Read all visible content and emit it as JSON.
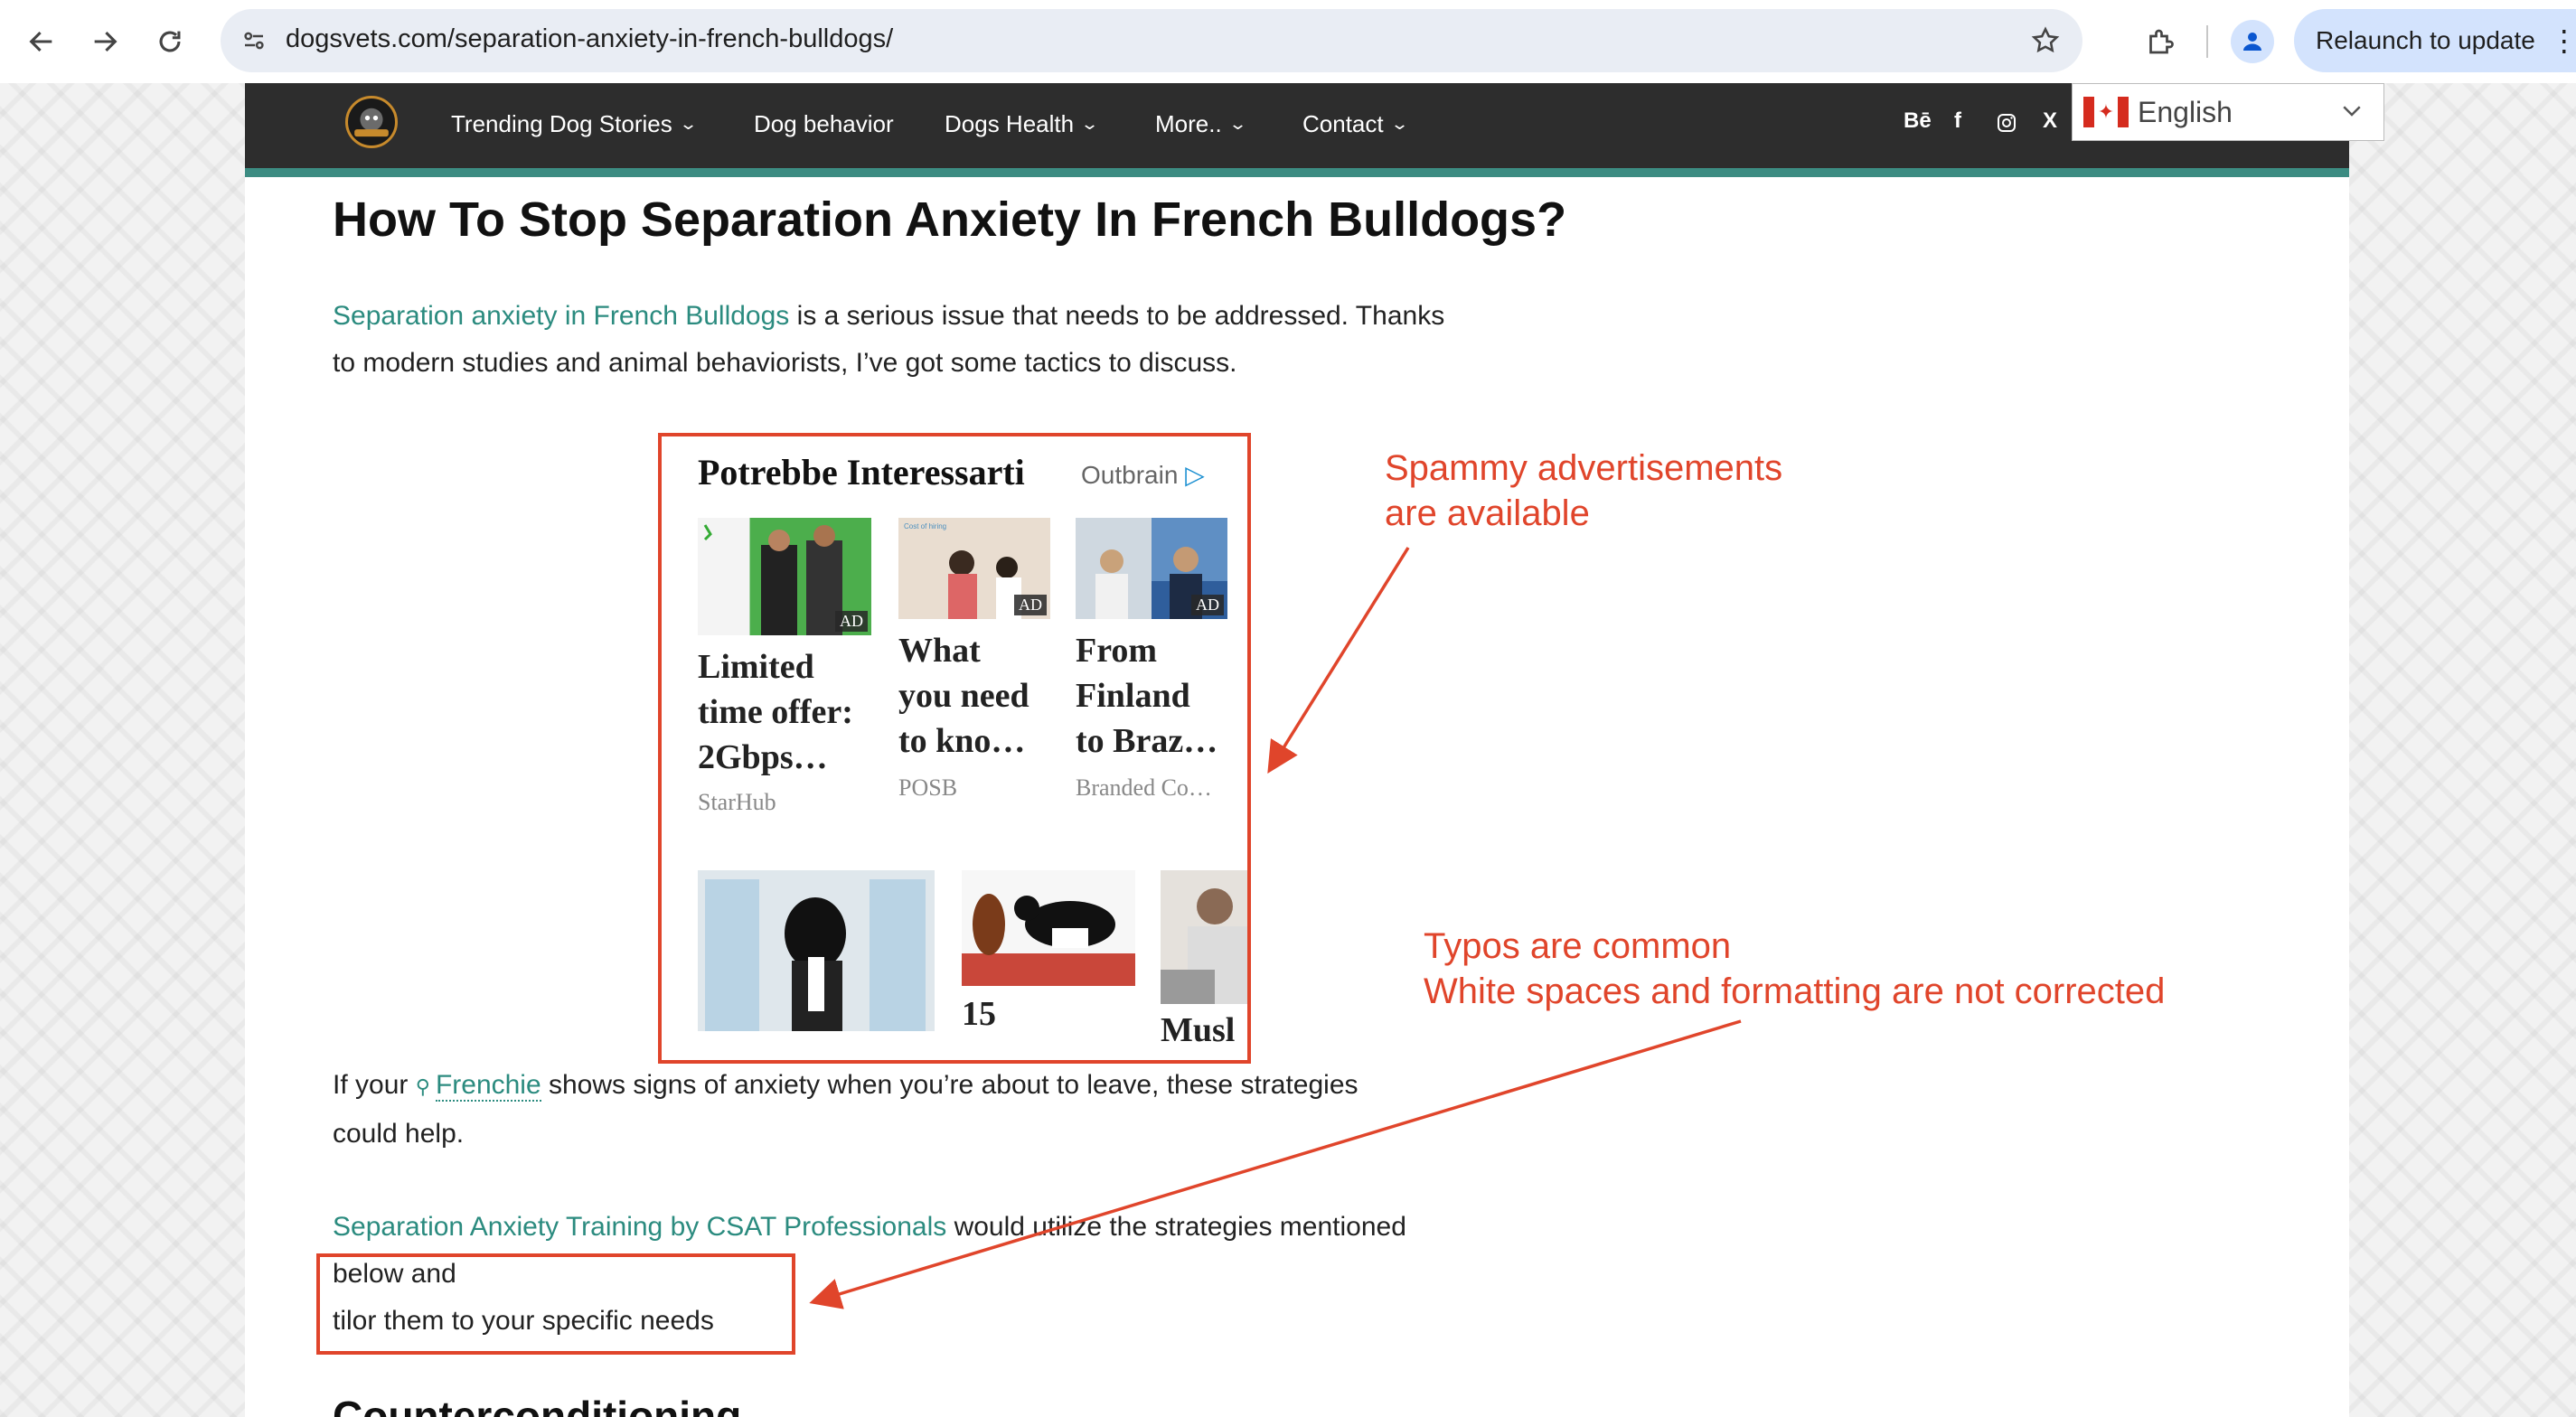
{
  "browser": {
    "url": "dogsvets.com/separation-anxiety-in-french-bulldogs/",
    "relaunch_label": "Relaunch to update"
  },
  "site_nav": {
    "items": [
      {
        "label": "Trending Dog Stories",
        "has_dropdown": true
      },
      {
        "label": "Dog behavior",
        "has_dropdown": false
      },
      {
        "label": "Dogs Health",
        "has_dropdown": true
      },
      {
        "label": "More..",
        "has_dropdown": true
      },
      {
        "label": "Contact",
        "has_dropdown": true
      }
    ],
    "social": [
      "Bē",
      "f",
      "instagram-icon",
      "X"
    ],
    "language": "English"
  },
  "article": {
    "title": "How To Stop Separation Anxiety In French Bulldogs?",
    "intro_link": "Separation anxiety in French Bulldogs",
    "intro_rest_1": " is a serious issue that needs to be addressed. Thanks",
    "intro_line_2": "to modern studies and animal behaviorists, I’ve got some tactics to discuss.",
    "p2_before": "If your ",
    "p2_link": "Frenchie",
    "p2_after": " shows signs of anxiety when you’re about to leave, these strategies",
    "p2_line_2": "could help.",
    "p3_link": "Separation Anxiety Training by CSAT Professionals",
    "p3_rest": " would utilize the strategies mentioned",
    "p3_line_2": "below and",
    "p3_line_3": "tilor them to your specific needs",
    "next_heading": "Counterconditioning"
  },
  "ad_widget": {
    "title": "Potrebbe Interessarti",
    "provider": "Outbrain",
    "badge": "AD",
    "cards": [
      {
        "headline": "Limited\ntime offer:\n2Gbps…",
        "source": "StarHub"
      },
      {
        "headline": "What\nyou need\nto kno…",
        "source": "POSB"
      },
      {
        "headline": "From\nFinland\nto Braz…",
        "source": "Branded Co…"
      },
      {
        "headline": "",
        "source": ""
      },
      {
        "headline": "15",
        "source": ""
      },
      {
        "headline": "Musl",
        "source": ""
      }
    ]
  },
  "annotations": {
    "ads_line_1": "Spammy advertisements",
    "ads_line_2": "are available",
    "typos_line_1": "Typos are common",
    "typos_line_2": "White spaces and formatting are not corrected"
  },
  "colors": {
    "accent_teal": "#3c8c82",
    "link": "#2b8b7f",
    "annotation_red": "#e0452b",
    "nav_bg": "#2d2d2d"
  }
}
